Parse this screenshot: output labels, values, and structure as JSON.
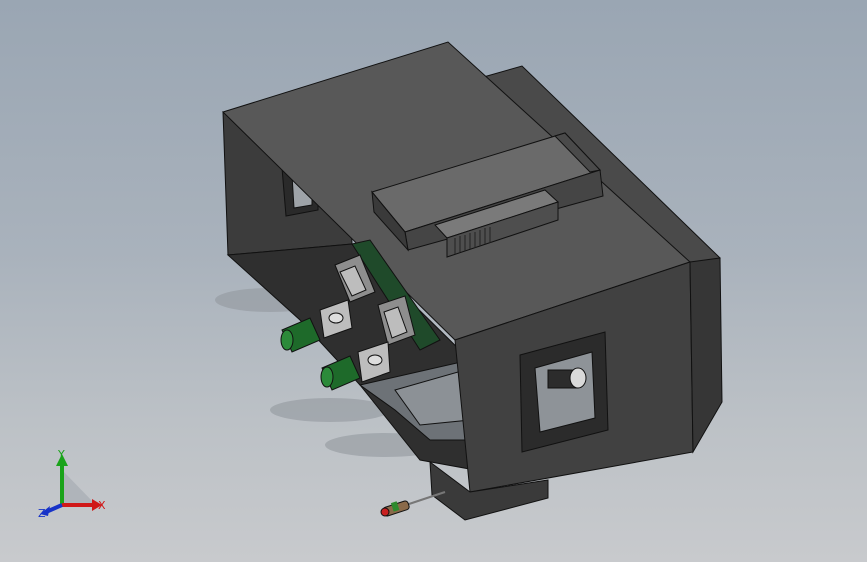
{
  "viewport": {
    "background_top": "#9aa6b3",
    "background_bottom": "#c8cacd"
  },
  "model": {
    "body_color": "#3f3f3f",
    "top_color": "#585858",
    "motor_color": "#1e6a2a",
    "edge_color": "#111111"
  },
  "triad": {
    "x_label": "X",
    "y_label": "Y",
    "z_label": "Z",
    "x_color": "#d01818",
    "y_color": "#1aa31a",
    "z_color": "#1833c8"
  }
}
